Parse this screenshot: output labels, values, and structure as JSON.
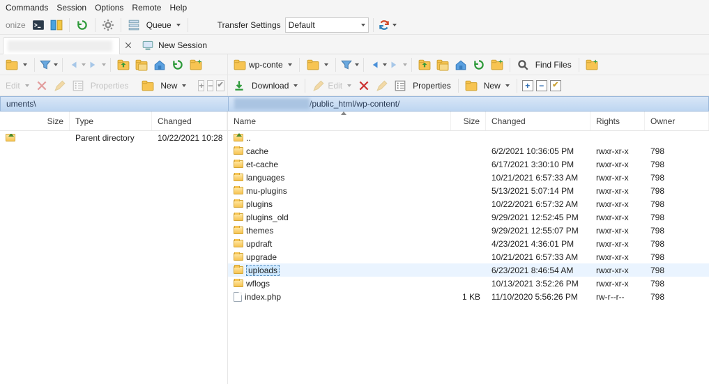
{
  "menubar": [
    "Commands",
    "Session",
    "Options",
    "Remote",
    "Help"
  ],
  "toolbar1": {
    "left_cut": "onize",
    "queue": "Queue",
    "transfer_label": "Transfer Settings",
    "transfer_value": "Default"
  },
  "tabs": {
    "new_session": "New Session"
  },
  "session": {
    "local_dir_label": "",
    "remote_dir_label": "wp-conte",
    "find_files": "Find Files"
  },
  "ops": {
    "edit": "Edit",
    "properties": "Properties",
    "new": "New",
    "download": "Download"
  },
  "paths": {
    "local": "uments\\",
    "remote": "/public_html/wp-content/",
    "remote_prefix_blur_width": 108
  },
  "left_cols": {
    "size": "Size",
    "type": "Type",
    "changed": "Changed"
  },
  "right_cols": {
    "name": "Name",
    "size": "Size",
    "changed": "Changed",
    "rights": "Rights",
    "owner": "Owner"
  },
  "left_rows": [
    {
      "icon": "up",
      "name": "..",
      "size": "",
      "type": "Parent directory",
      "changed": "10/22/2021 10:28"
    }
  ],
  "right_rows": [
    {
      "icon": "up",
      "name": "..",
      "size": "",
      "changed": "",
      "rights": "",
      "owner": "",
      "selected": false
    },
    {
      "icon": "folder",
      "name": "cache",
      "size": "",
      "changed": "6/2/2021 10:36:05 PM",
      "rights": "rwxr-xr-x",
      "owner": "798"
    },
    {
      "icon": "folder",
      "name": "et-cache",
      "size": "",
      "changed": "6/17/2021 3:30:10 PM",
      "rights": "rwxr-xr-x",
      "owner": "798"
    },
    {
      "icon": "folder",
      "name": "languages",
      "size": "",
      "changed": "10/21/2021 6:57:33 AM",
      "rights": "rwxr-xr-x",
      "owner": "798"
    },
    {
      "icon": "folder",
      "name": "mu-plugins",
      "size": "",
      "changed": "5/13/2021 5:07:14 PM",
      "rights": "rwxr-xr-x",
      "owner": "798"
    },
    {
      "icon": "folder",
      "name": "plugins",
      "size": "",
      "changed": "10/22/2021 6:57:32 AM",
      "rights": "rwxr-xr-x",
      "owner": "798"
    },
    {
      "icon": "folder",
      "name": "plugins_old",
      "size": "",
      "changed": "9/29/2021 12:52:45 PM",
      "rights": "rwxr-xr-x",
      "owner": "798"
    },
    {
      "icon": "folder",
      "name": "themes",
      "size": "",
      "changed": "9/29/2021 12:55:07 PM",
      "rights": "rwxr-xr-x",
      "owner": "798"
    },
    {
      "icon": "folder",
      "name": "updraft",
      "size": "",
      "changed": "4/23/2021 4:36:01 PM",
      "rights": "rwxr-xr-x",
      "owner": "798"
    },
    {
      "icon": "folder",
      "name": "upgrade",
      "size": "",
      "changed": "10/21/2021 6:57:33 AM",
      "rights": "rwxr-xr-x",
      "owner": "798"
    },
    {
      "icon": "folder",
      "name": "uploads",
      "size": "",
      "changed": "6/23/2021 8:46:54 AM",
      "rights": "rwxr-xr-x",
      "owner": "798",
      "selected": true
    },
    {
      "icon": "folder",
      "name": "wflogs",
      "size": "",
      "changed": "10/13/2021 3:52:26 PM",
      "rights": "rwxr-xr-x",
      "owner": "798"
    },
    {
      "icon": "file",
      "name": "index.php",
      "size": "1 KB",
      "changed": "11/10/2020 5:56:26 PM",
      "rights": "rw-r--r--",
      "owner": "798"
    }
  ]
}
